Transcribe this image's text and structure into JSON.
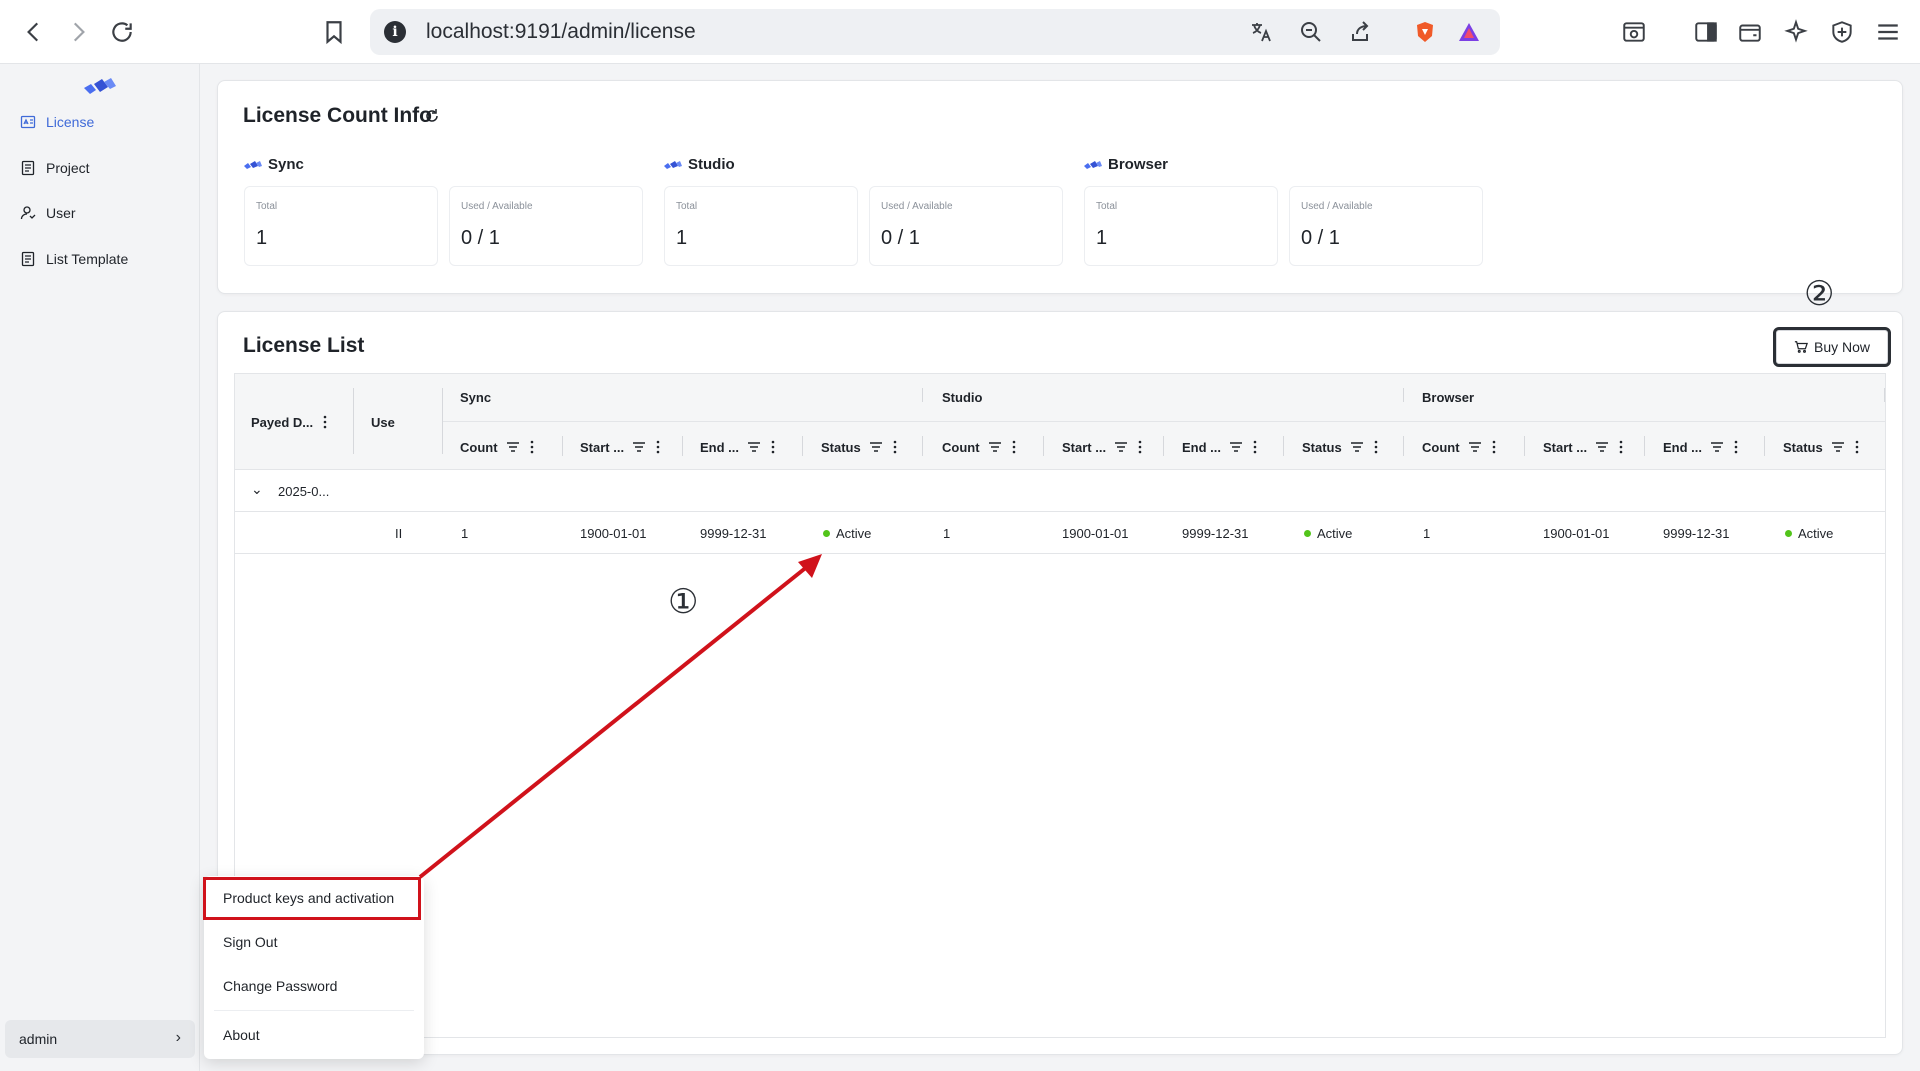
{
  "browser": {
    "url": "localhost:9191/admin/license",
    "info_glyph": "i"
  },
  "sidebar": {
    "items": [
      {
        "label": "License",
        "icon": "license-icon",
        "active": true
      },
      {
        "label": "Project",
        "icon": "project-icon",
        "active": false
      },
      {
        "label": "User",
        "icon": "user-icon",
        "active": false
      },
      {
        "label": "List Template",
        "icon": "template-icon",
        "active": false
      }
    ],
    "user": "admin",
    "user_chevron": "›"
  },
  "count_info": {
    "title": "License Count Info",
    "products": [
      {
        "name": "Sync",
        "total_label": "Total",
        "total": "1",
        "used_label": "Used / Available",
        "used": "0 / 1"
      },
      {
        "name": "Studio",
        "total_label": "Total",
        "total": "1",
        "used_label": "Used / Available",
        "used": "0 / 1"
      },
      {
        "name": "Browser",
        "total_label": "Total",
        "total": "1",
        "used_label": "Used / Available",
        "used": "0 / 1"
      }
    ]
  },
  "license_list": {
    "title": "License List",
    "buy_label": "Buy Now",
    "headers": {
      "payed": "Payed D...",
      "use": "Use",
      "groups": [
        "Sync",
        "Studio",
        "Browser"
      ],
      "sub": [
        "Count",
        "Start ...",
        "End ...",
        "Status"
      ]
    },
    "group_row": {
      "label": "2025-0...",
      "chevron": "⌄"
    },
    "rows": [
      {
        "use": "II",
        "groups": [
          {
            "count": "1",
            "start": "1900-01-01",
            "end": "9999-12-31",
            "status": "Active"
          },
          {
            "count": "1",
            "start": "1900-01-01",
            "end": "9999-12-31",
            "status": "Active"
          },
          {
            "count": "1",
            "start": "1900-01-01",
            "end": "9999-12-31",
            "status": "Active"
          }
        ]
      }
    ]
  },
  "menu": {
    "items": [
      "Product keys and activation",
      "Sign Out",
      "Change Password",
      "About"
    ]
  },
  "annotations": {
    "marker1": "①",
    "marker2": "②",
    "highlight_color": "#d0121b"
  },
  "colors": {
    "accent": "#3f6ad8",
    "active_dot": "#52c41a"
  }
}
